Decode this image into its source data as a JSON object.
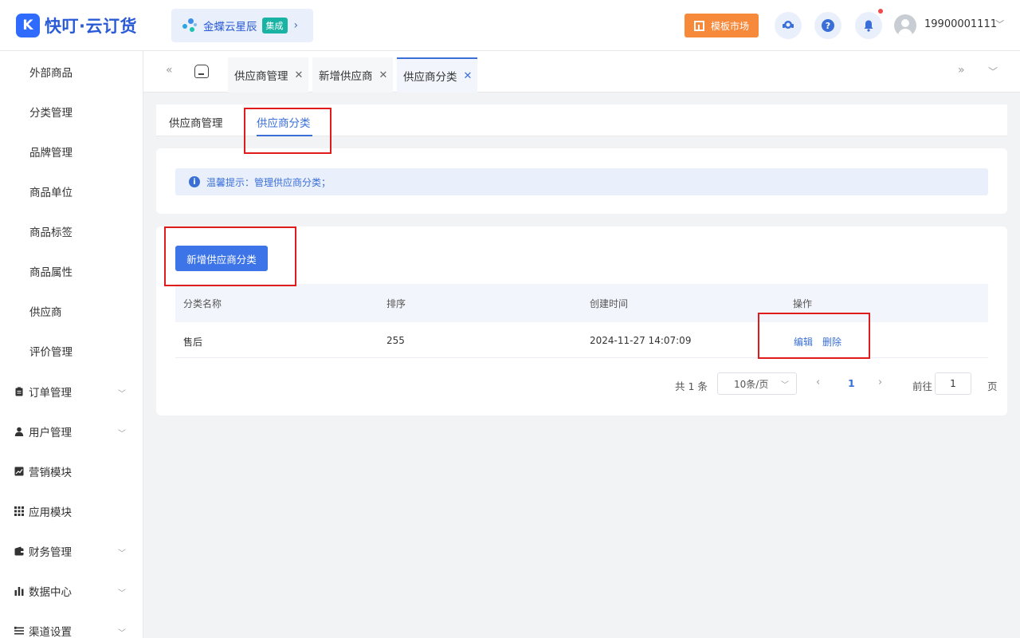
{
  "header": {
    "logo_mark": "K",
    "app_name": "快叮·云订货",
    "brand_name": "金蝶云星辰",
    "brand_badge": "集成",
    "market_label": "模板市场",
    "help_glyph": "?",
    "username": "19900001111"
  },
  "sidebar": {
    "sub_items": [
      "外部商品",
      "分类管理",
      "品牌管理",
      "商品单位",
      "商品标签",
      "商品属性",
      "供应商",
      "评价管理"
    ],
    "groups": [
      {
        "label": "订单管理",
        "icon": "clipboard-icon",
        "has_chevron": true
      },
      {
        "label": "用户管理",
        "icon": "user-icon",
        "has_chevron": true
      },
      {
        "label": "营销模块",
        "icon": "trend-chart-icon",
        "has_chevron": false
      },
      {
        "label": "应用模块",
        "icon": "grid-apps-icon",
        "has_chevron": false
      },
      {
        "label": "财务管理",
        "icon": "wallet-icon",
        "has_chevron": true
      },
      {
        "label": "数据中心",
        "icon": "bar-chart-icon",
        "has_chevron": true
      },
      {
        "label": "渠道设置",
        "icon": "list-settings-icon",
        "has_chevron": true
      }
    ]
  },
  "page_tabs": [
    {
      "label": "供应商管理",
      "active": false
    },
    {
      "label": "新增供应商",
      "active": false
    },
    {
      "label": "供应商分类",
      "active": true
    }
  ],
  "sub_tabs": [
    {
      "label": "供应商管理",
      "active": false
    },
    {
      "label": "供应商分类",
      "active": true
    }
  ],
  "tip": {
    "glyph": "i",
    "text": "温馨提示：管理供应商分类；"
  },
  "toolbar": {
    "add_label": "新增供应商分类"
  },
  "table": {
    "columns": [
      "分类名称",
      "排序",
      "创建时间",
      "操作"
    ],
    "rows": [
      {
        "name": "售后",
        "sort": "255",
        "created": "2024-11-27 14:07:09",
        "actions": [
          "编辑",
          "删除"
        ]
      }
    ]
  },
  "pagination": {
    "total": "共 1 条",
    "page_size": "10条/页",
    "current_page": "1",
    "goto_label": "前往",
    "goto_value": "1",
    "page_suffix": "页"
  },
  "colors": {
    "accent": "#3a6fd8",
    "primary_button": "#3d74e8",
    "market_button": "#f7893b",
    "badge": "#19b3a3",
    "annotation_box": "#e01b1b"
  }
}
